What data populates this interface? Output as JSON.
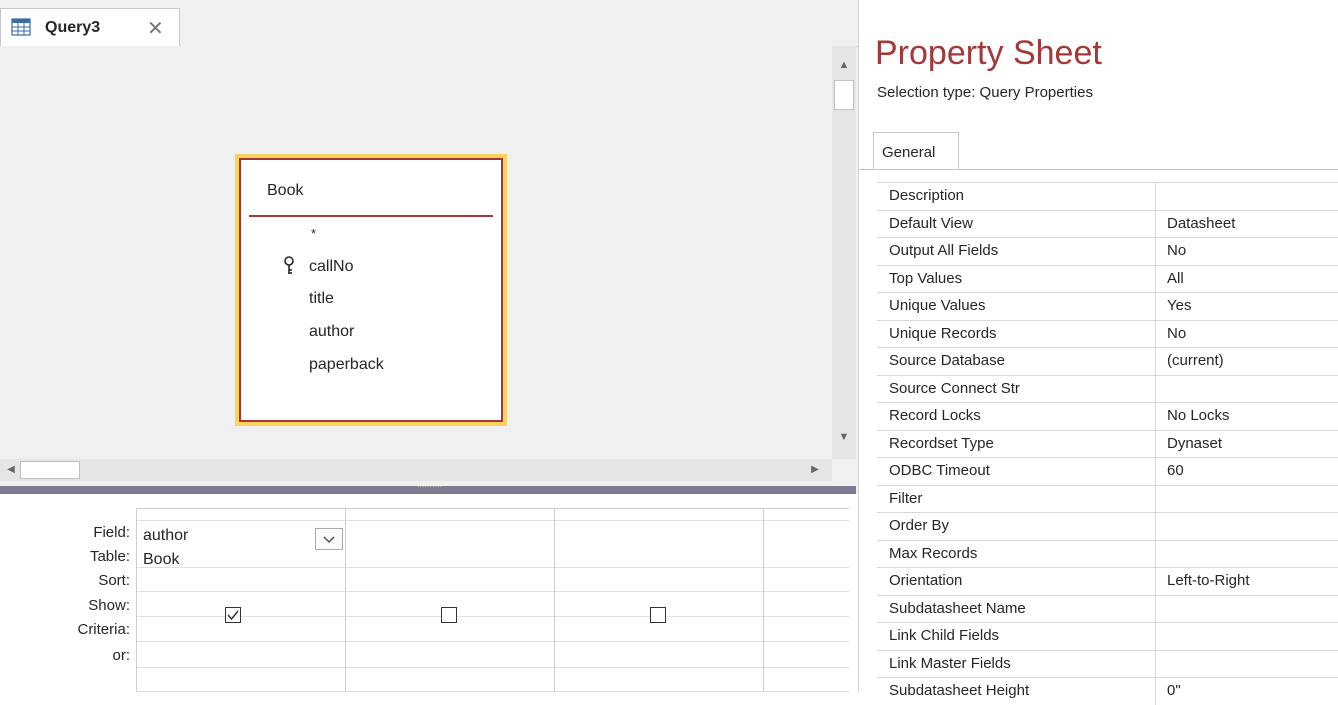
{
  "query_tab": {
    "title": "Query3",
    "close_icon": "close-icon",
    "icon": "query-design-icon"
  },
  "table_box": {
    "title": "Book",
    "fields": [
      "*",
      "callNo",
      "title",
      "author",
      "paperback"
    ],
    "primary_key_field": "callNo"
  },
  "qbe": {
    "row_labels": [
      "Field:",
      "Table:",
      "Sort:",
      "Show:",
      "Criteria:",
      "or:"
    ],
    "columns": [
      {
        "field": "author",
        "table": "Book",
        "show": true
      },
      {
        "field": "",
        "table": "",
        "show": false
      },
      {
        "field": "",
        "table": "",
        "show": false
      }
    ]
  },
  "property_sheet": {
    "title": "Property Sheet",
    "selection_type": "Selection type:  Query Properties",
    "tab": "General",
    "properties": [
      {
        "name": "Description",
        "value": ""
      },
      {
        "name": "Default View",
        "value": "Datasheet"
      },
      {
        "name": "Output All Fields",
        "value": "No"
      },
      {
        "name": "Top Values",
        "value": "All"
      },
      {
        "name": "Unique Values",
        "value": "Yes"
      },
      {
        "name": "Unique Records",
        "value": "No"
      },
      {
        "name": "Source Database",
        "value": "(current)"
      },
      {
        "name": "Source Connect Str",
        "value": ""
      },
      {
        "name": "Record Locks",
        "value": "No Locks"
      },
      {
        "name": "Recordset Type",
        "value": "Dynaset"
      },
      {
        "name": "ODBC Timeout",
        "value": "60"
      },
      {
        "name": "Filter",
        "value": ""
      },
      {
        "name": "Order By",
        "value": ""
      },
      {
        "name": "Max Records",
        "value": ""
      },
      {
        "name": "Orientation",
        "value": "Left-to-Right"
      },
      {
        "name": "Subdatasheet Name",
        "value": ""
      },
      {
        "name": "Link Child Fields",
        "value": ""
      },
      {
        "name": "Link Master Fields",
        "value": ""
      },
      {
        "name": "Subdatasheet Height",
        "value": "0\""
      }
    ]
  },
  "colors": {
    "accent": "#a4373a",
    "table_highlight": "#fbd25b",
    "splitter": "#7c7c8e"
  }
}
